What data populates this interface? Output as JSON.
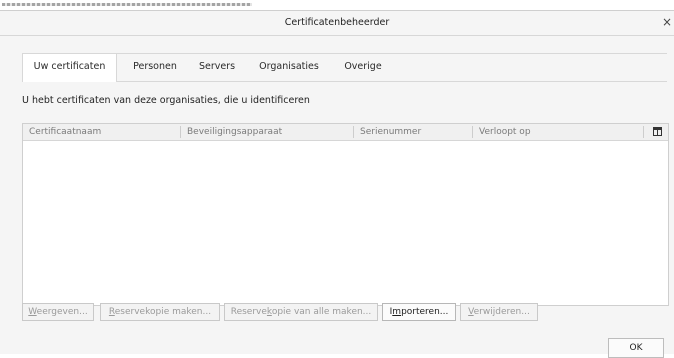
{
  "window": {
    "title": "Certificatenbeheerder",
    "close_glyph": "×"
  },
  "tabs": [
    {
      "label": "Uw certificaten"
    },
    {
      "label": "Personen"
    },
    {
      "label": "Servers"
    },
    {
      "label": "Organisaties"
    },
    {
      "label": "Overige"
    }
  ],
  "active_tab": "Uw certificaten",
  "description": "U hebt certificaten van deze organisaties, die u identificeren",
  "table": {
    "columns": [
      "Certificaatnaam",
      "Beveiligingsapparaat",
      "Serienummer",
      "Verloopt op"
    ],
    "rows": [],
    "column_picker_icon": "column-picker-icon"
  },
  "buttons": {
    "view": {
      "pre": "",
      "access": "W",
      "post": "eergeven...",
      "enabled": false
    },
    "backup": {
      "pre": "",
      "access": "R",
      "post": "eservekopie maken...",
      "enabled": false
    },
    "backup_all": {
      "pre": "Reserve",
      "access": "k",
      "post": "opie van alle maken...",
      "enabled": false
    },
    "import": {
      "pre": "I",
      "access": "m",
      "post": "porteren...",
      "enabled": true
    },
    "delete": {
      "pre": "",
      "access": "V",
      "post": "erwijderen...",
      "enabled": false
    }
  },
  "ok_label": "OK"
}
